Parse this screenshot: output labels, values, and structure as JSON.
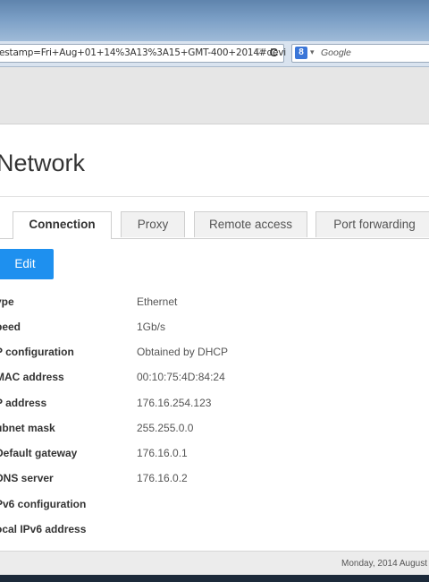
{
  "browser": {
    "url": "estamp=Fri+Aug+01+14%3A13%3A15+GMT-400+2014#devi",
    "search_placeholder": "Google",
    "search_engine_letter": "8"
  },
  "page": {
    "title": "Network",
    "tabs": [
      {
        "label": "Connection",
        "active": true
      },
      {
        "label": "Proxy",
        "active": false
      },
      {
        "label": "Remote access",
        "active": false
      },
      {
        "label": "Port forwarding",
        "active": false
      }
    ],
    "edit_label": "Edit",
    "fields": [
      {
        "key": "ype",
        "value": "Ethernet"
      },
      {
        "key": "peed",
        "value": "1Gb/s"
      },
      {
        "key": "P configuration",
        "value": "Obtained by DHCP"
      },
      {
        "key": "MAC address",
        "value": "00:10:75:4D:84:24"
      },
      {
        "key": "P address",
        "value": "176.16.254.123"
      },
      {
        "key": "ubnet mask",
        "value": "255.255.0.0"
      },
      {
        "key": "Default gateway",
        "value": "176.16.0.1"
      },
      {
        "key": "DNS server",
        "value": "176.16.0.2"
      },
      {
        "key": "Pv6 configuration",
        "value": ""
      },
      {
        "key": "ocal IPv6 address",
        "value": ""
      }
    ]
  },
  "footer": {
    "date": "Monday, 2014 August"
  },
  "colors": {
    "accent": "#1e90ef"
  }
}
